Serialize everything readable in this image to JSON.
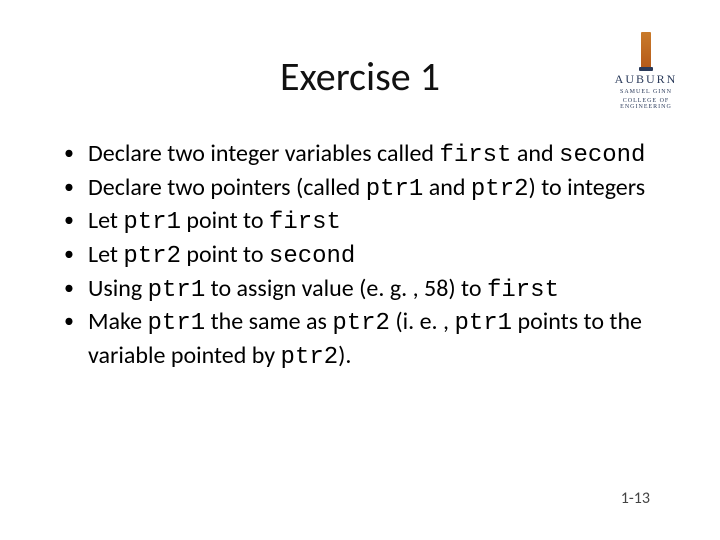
{
  "title": "Exercise 1",
  "logo": {
    "university": "AUBURN",
    "sub1": "SAMUEL GINN",
    "sub2": "COLLEGE OF ENGINEERING"
  },
  "bullets": [
    {
      "t0": "Declare two integer variables called ",
      "c0": "first",
      "t1": " and ",
      "c1": "second",
      "t2": ""
    },
    {
      "t0": "Declare two pointers (called ",
      "c0": "ptr1",
      "t1": " and ",
      "c1": "ptr2",
      "t2": ") to integers"
    },
    {
      "t0": "Let ",
      "c0": "ptr1",
      "t1": " point to ",
      "c1": "first",
      "t2": ""
    },
    {
      "t0": "Let  ",
      "c0": "ptr2",
      "t1": " point to ",
      "c1": "second",
      "t2": ""
    },
    {
      "t0": "Using ",
      "c0": "ptr1",
      "t1": " to assign value (e. g. , 58) to ",
      "c1": "first",
      "t2": ""
    },
    {
      "t0": "Make ",
      "c0": "ptr1",
      "t1": " the same as ",
      "c1": "ptr2",
      "t2": " (i. e. , ",
      "c2": "ptr1",
      "t3": " points to the variable pointed by ",
      "c3": "ptr2",
      "t4": ")."
    }
  ],
  "pagenum": "1-13"
}
